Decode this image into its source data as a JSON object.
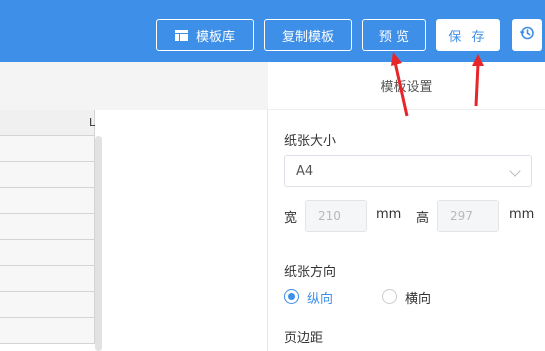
{
  "toolbar": {
    "template_library": "模板库",
    "copy_template": "复制模板",
    "preview": "预 览",
    "save": "保 存"
  },
  "sheet": {
    "column_l": "L"
  },
  "settings": {
    "title": "模板设置",
    "paper_size_label": "纸张大小",
    "paper_size_value": "A4",
    "width_label": "宽",
    "width_value": "210",
    "width_unit": "mm",
    "height_label": "高",
    "height_value": "297",
    "height_unit": "mm",
    "orientation_label": "纸张方向",
    "portrait": "纵向",
    "landscape": "横向",
    "margin_label": "页边距"
  },
  "colors": {
    "accent": "#3d8fe8",
    "arrow": "#e8262a"
  }
}
